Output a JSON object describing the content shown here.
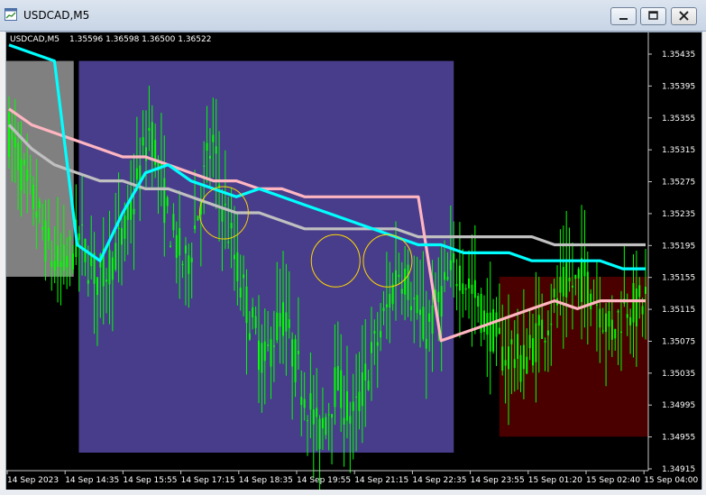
{
  "window": {
    "title": "USDCAD,M5"
  },
  "chart_header": {
    "symbol": "USDCAD,M5",
    "ohlc": "1.35596 1.36598 1.36500 1.36522"
  },
  "colors": {
    "background": "#000000",
    "candles": "#00ff00",
    "ma_fast": "#00ffff",
    "ma_mid": "#c0c0c0",
    "ma_slow": "#ffb6c1",
    "zone_session_1": "#808080",
    "zone_session_2": "#483d8b",
    "zone_session_3": "#4b0000",
    "markers": "#ffd700"
  },
  "chart_data": {
    "type": "candlestick",
    "y_ticks": [
      "1.35435",
      "1.35395",
      "1.35355",
      "1.35315",
      "1.35275",
      "1.35235",
      "1.35195",
      "1.35155",
      "1.35115",
      "1.35075",
      "1.35035",
      "1.34995",
      "1.34955",
      "1.34915"
    ],
    "y_range": [
      1.3491,
      1.3546
    ],
    "x_ticks": [
      "14 Sep 2023",
      "14 Sep 14:35",
      "14 Sep 15:55",
      "14 Sep 17:15",
      "14 Sep 18:35",
      "14 Sep 19:55",
      "14 Sep 21:15",
      "14 Sep 22:35",
      "14 Sep 23:55",
      "15 Sep 01:20",
      "15 Sep 02:40",
      "15 Sep 04:00"
    ],
    "price_path": [
      1.5334,
      1.5331,
      1.5327,
      1.5325,
      1.5321,
      1.5318,
      1.5317,
      1.5319,
      1.5321,
      1.5318,
      1.5316,
      1.5317,
      1.5319,
      1.5321,
      1.5325,
      1.533,
      1.5335,
      1.5329,
      1.5323,
      1.532,
      1.5317,
      1.5322,
      1.5328,
      1.5333,
      1.5326,
      1.5321,
      1.5316,
      1.5312,
      1.5308,
      1.5305,
      1.5309,
      1.5311,
      1.5307,
      1.5303,
      1.53,
      1.5296,
      1.5299,
      1.5303,
      1.53,
      1.5298,
      1.5302,
      1.5306,
      1.5309,
      1.5313,
      1.5317,
      1.5316,
      1.5312,
      1.5309,
      1.5311,
      1.5314,
      1.5316,
      1.5317,
      1.5315,
      1.5313,
      1.531,
      1.5309,
      1.5306,
      1.5307,
      1.5305,
      1.5307,
      1.5309,
      1.5311,
      1.5313,
      1.5315,
      1.5315,
      1.5316,
      1.5314,
      1.5312,
      1.5309,
      1.5311,
      1.5313,
      1.5312,
      1.5313
    ],
    "price_scale_note": "",
    "zones": [
      {
        "from": 0.0,
        "to": 0.105,
        "top": 1.5343,
        "bottom": 1.5316
      },
      {
        "from": 0.113,
        "to": 0.697,
        "top": 1.5343,
        "bottom": 1.5294
      },
      {
        "from": 0.768,
        "to": 1.0,
        "top": 1.5316,
        "bottom": 1.5296
      }
    ],
    "ma_fast": [
      1.5345,
      1.5344,
      1.5343,
      1.532,
      1.5318,
      1.5324,
      1.5329,
      1.533,
      1.5328,
      1.5327,
      1.5326,
      1.5327,
      1.5326,
      1.5325,
      1.5324,
      1.5323,
      1.5322,
      1.5321,
      1.532,
      1.532,
      1.5319,
      1.5319,
      1.5319,
      1.5318,
      1.5318,
      1.5318,
      1.5318,
      1.5317,
      1.5317
    ],
    "ma_mid": [
      1.5335,
      1.5332,
      1.533,
      1.5329,
      1.5328,
      1.5328,
      1.5327,
      1.5327,
      1.5326,
      1.5325,
      1.5324,
      1.5324,
      1.5323,
      1.5322,
      1.5322,
      1.5322,
      1.5322,
      1.5322,
      1.5321,
      1.5321,
      1.5321,
      1.5321,
      1.5321,
      1.5321,
      1.532,
      1.532,
      1.532,
      1.532,
      1.532
    ],
    "ma_slow": [
      1.5337,
      1.5335,
      1.5334,
      1.5333,
      1.5332,
      1.5331,
      1.5331,
      1.533,
      1.5329,
      1.5328,
      1.5328,
      1.5327,
      1.5327,
      1.5326,
      1.5326,
      1.5326,
      1.5326,
      1.5326,
      1.5326,
      1.5308,
      1.5309,
      1.531,
      1.5311,
      1.5312,
      1.5313,
      1.5312,
      1.5313,
      1.5313,
      1.5313
    ],
    "circles": [
      {
        "x": 0.339,
        "price": 1.5324
      },
      {
        "x": 0.513,
        "price": 1.5318
      },
      {
        "x": 0.594,
        "price": 1.5318
      }
    ]
  }
}
